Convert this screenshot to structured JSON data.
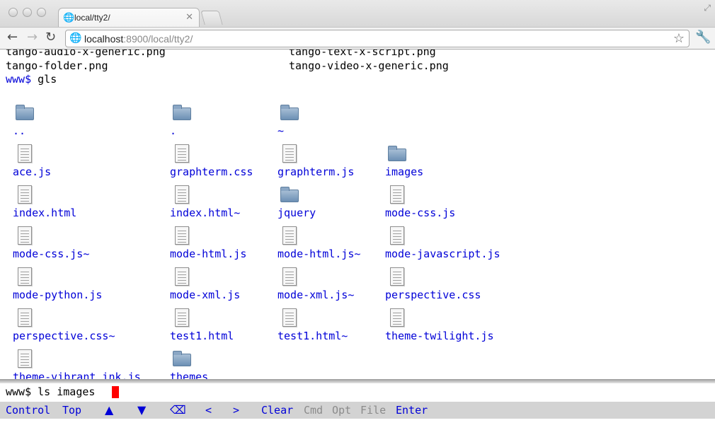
{
  "browser": {
    "tab_title": "local/tty2/",
    "url_host": "localhost",
    "url_path": ":8900/local/tty2/",
    "icons": {
      "back": "back-arrow-icon",
      "forward": "forward-arrow-icon",
      "reload": "reload-icon",
      "bookmark": "star-icon",
      "settings": "wrench-icon"
    }
  },
  "terminal": {
    "output_lines": [
      {
        "left": "tango-audio-x-generic.png",
        "right": "tango-text-x-script.png"
      },
      {
        "left": "tango-folder.png",
        "right": "tango-video-x-generic.png"
      }
    ],
    "prompt": "www$",
    "last_command": "gls",
    "files": [
      {
        "name": "..",
        "type": "folder"
      },
      {
        "name": ".",
        "type": "folder"
      },
      {
        "name": "~",
        "type": "folder"
      },
      {
        "name": "ace.js",
        "type": "file"
      },
      {
        "name": "graphterm.css",
        "type": "file"
      },
      {
        "name": "graphterm.js",
        "type": "file"
      },
      {
        "name": "images",
        "type": "folder"
      },
      {
        "name": "index.html",
        "type": "file"
      },
      {
        "name": "index.html~",
        "type": "file"
      },
      {
        "name": "jquery",
        "type": "folder"
      },
      {
        "name": "mode-css.js",
        "type": "file"
      },
      {
        "name": "mode-css.js~",
        "type": "file"
      },
      {
        "name": "mode-html.js",
        "type": "file"
      },
      {
        "name": "mode-html.js~",
        "type": "file"
      },
      {
        "name": "mode-javascript.js",
        "type": "file"
      },
      {
        "name": "mode-python.js",
        "type": "file"
      },
      {
        "name": "mode-xml.js",
        "type": "file"
      },
      {
        "name": "mode-xml.js~",
        "type": "file"
      },
      {
        "name": "perspective.css",
        "type": "file"
      },
      {
        "name": "perspective.css~",
        "type": "file"
      },
      {
        "name": "test1.html",
        "type": "file"
      },
      {
        "name": "test1.html~",
        "type": "file"
      },
      {
        "name": "theme-twilight.js",
        "type": "file"
      },
      {
        "name": "theme-vibrant_ink.js",
        "type": "file"
      },
      {
        "name": "themes",
        "type": "folder"
      }
    ]
  },
  "command_line": {
    "prompt": "www$",
    "input": "ls images"
  },
  "keyboard_bar": {
    "control": "Control",
    "top": "Top",
    "up": "▲",
    "down": "▼",
    "backspace": "⌫",
    "left": "<",
    "right": ">",
    "clear": "Clear",
    "cmd": "Cmd",
    "opt": "Opt",
    "file": "File",
    "enter": "Enter"
  },
  "colors": {
    "link": "#0000d8",
    "cursor": "#ff0000",
    "disabled_key": "#8b8b8b",
    "key_bar_bg": "#d3d3d3"
  }
}
